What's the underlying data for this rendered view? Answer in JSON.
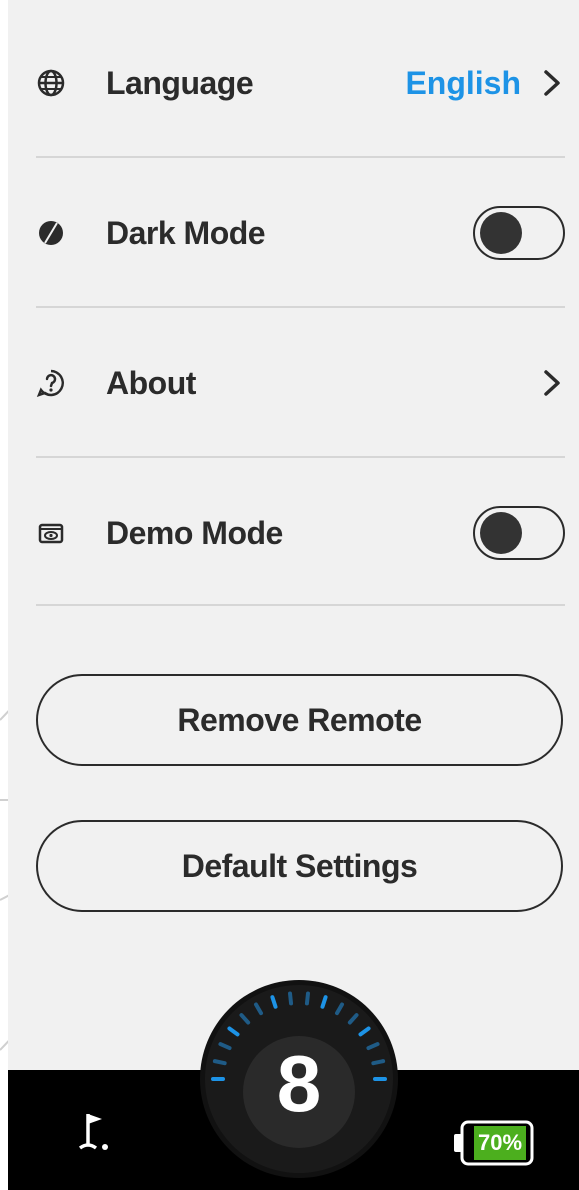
{
  "settings": {
    "language": {
      "label": "Language",
      "value": "English"
    },
    "dark_mode": {
      "label": "Dark Mode",
      "enabled": false
    },
    "about": {
      "label": "About"
    },
    "demo_mode": {
      "label": "Demo Mode",
      "enabled": false
    }
  },
  "actions": {
    "remove_remote": "Remove Remote",
    "default_settings": "Default Settings"
  },
  "bottom": {
    "dial_value": "8",
    "battery": "70%",
    "battery_level": 0.7
  },
  "colors": {
    "accent": "#1d93e6",
    "text": "#2b2b2b",
    "background": "#f1f1f1",
    "battery": "#4caf1e"
  },
  "icons": {
    "language": "globe-icon",
    "dark_mode": "contrast-icon",
    "about": "question-icon",
    "demo_mode": "eye-icon",
    "chevron": "chevron-right-icon",
    "flag": "golf-flag-icon",
    "battery": "battery-icon"
  }
}
